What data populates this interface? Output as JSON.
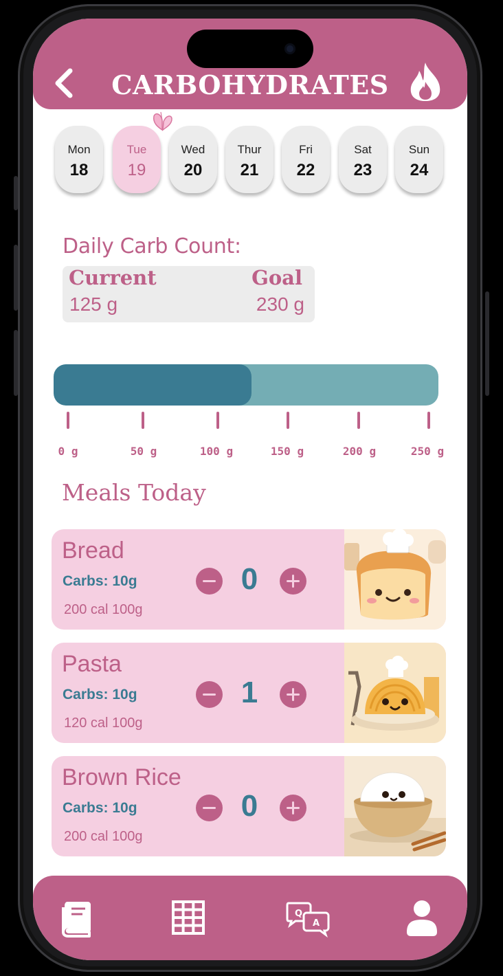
{
  "header": {
    "title": "CARBOHYDRATES"
  },
  "icons": {
    "back": "chevron-left-icon",
    "flame": "flame-icon",
    "butterfly": "butterfly-icon",
    "tabs": [
      "book-icon",
      "grid-table-icon",
      "qa-chat-icon",
      "user-icon"
    ]
  },
  "days": [
    {
      "name": "Mon",
      "num": "18"
    },
    {
      "name": "Tue",
      "num": "19",
      "selected": true
    },
    {
      "name": "Wed",
      "num": "20"
    },
    {
      "name": "Thur",
      "num": "21"
    },
    {
      "name": "Fri",
      "num": "22"
    },
    {
      "name": "Sat",
      "num": "23"
    },
    {
      "name": "Sun",
      "num": "24"
    }
  ],
  "carb_count": {
    "label": "Daily Carb Count:",
    "current_label": "Current",
    "current_value": "125 g",
    "goal_label": "Goal",
    "goal_value": "230 g"
  },
  "progress": {
    "current_g": 125,
    "max_g": 250,
    "tick_labels": [
      "0 g",
      "50 g",
      "100 g",
      "150 g",
      "200 g",
      "250 g"
    ]
  },
  "meals_title": "Meals Today",
  "meals": [
    {
      "name": "Bread",
      "carbs": "Carbs: 10g",
      "info": "200 cal 100g",
      "qty": "0",
      "image": "bread-illustration"
    },
    {
      "name": "Pasta",
      "carbs": "Carbs: 10g",
      "info": "120 cal 100g",
      "qty": "1",
      "image": "pasta-illustration"
    },
    {
      "name": "Brown Rice",
      "carbs": "Carbs: 10g",
      "info": "200 cal 100g",
      "qty": "0",
      "image": "rice-illustration"
    }
  ],
  "colors": {
    "brand_pink": "#bd6088",
    "light_pink": "#f5cfe1",
    "teal_dark": "#3a7b92",
    "teal_light": "#74adb4",
    "card_gray": "#ececec"
  }
}
